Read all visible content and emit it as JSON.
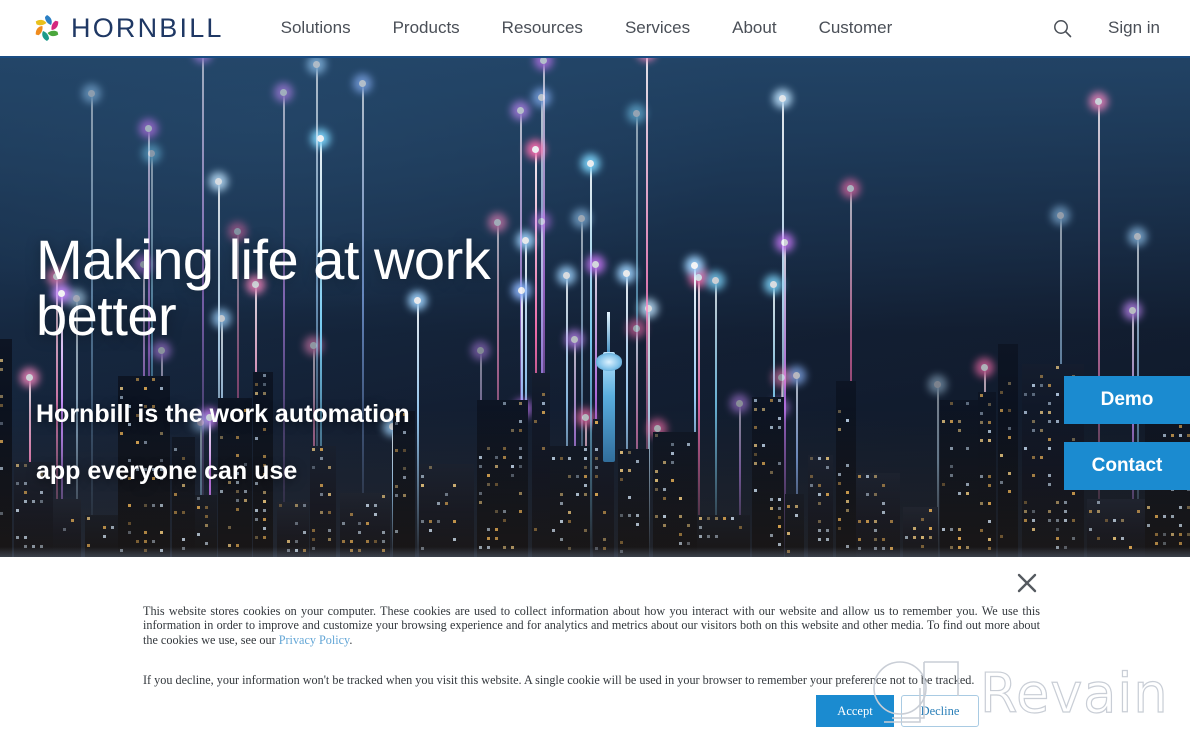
{
  "header": {
    "brand": {
      "name": "HORNBILL",
      "logo_icon": "hornbill-pinwheel-logo",
      "color": "#1f3864"
    },
    "nav": [
      {
        "label": "Solutions"
      },
      {
        "label": "Products"
      },
      {
        "label": "Resources"
      },
      {
        "label": "Services"
      },
      {
        "label": "About"
      },
      {
        "label": "Customer"
      }
    ],
    "search_icon": "search-icon",
    "signin_label": "Sign in"
  },
  "hero": {
    "title": "Making life at work better",
    "subtitle_line1": "Hornbill is the work automation",
    "subtitle_line2": "app everyone can use",
    "cta": [
      {
        "label": "Demo",
        "color": "#1b8bd0"
      },
      {
        "label": "Contact",
        "color": "#1b8bd0"
      }
    ]
  },
  "cookie_banner": {
    "close_icon": "close-icon",
    "paragraph1_part1": "This website stores cookies on your computer. These cookies are used to collect information about how you interact with our website and allow us to remember you. We use this information in order to improve and customize your browsing experience and for analytics and metrics about our visitors both on this website and other media. To find out more about the cookies we use, see our ",
    "privacy_link": "Privacy Policy",
    "paragraph1_part2": ".",
    "paragraph2": "If you decline, your information won't be tracked when you visit this website. A single cookie will be used in your browser to remember your preference not to be tracked.",
    "accept_label": "Accept",
    "decline_label": "Decline",
    "accent_color": "#1b8bd0",
    "link_color": "#63a6d6"
  },
  "watermark": {
    "text": "Revain",
    "logo_icon": "revain-logo-outline",
    "color": "#c9ced6"
  }
}
